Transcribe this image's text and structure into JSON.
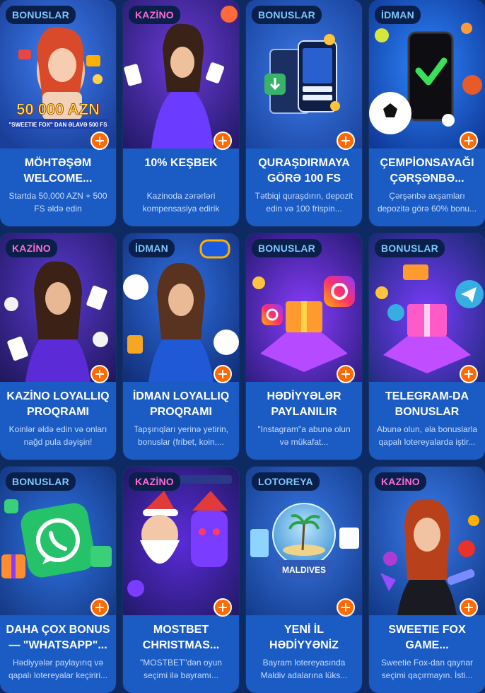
{
  "cards": [
    {
      "badge": "BONUSLAR",
      "badge_type": "bonus",
      "title_line1": "MÖHTƏŞƏM",
      "title_line2": "WELCOME...",
      "desc_line1": "Startda 50,000 AZN + 500",
      "desc_line2": "FS əldə edin",
      "image_text1": "50 000 AZN",
      "image_text2": "\"SWEETIE FOX\" DAN ƏLAVƏ 500 FS"
    },
    {
      "badge": "KAZİNO",
      "badge_type": "kazino",
      "title_line1": "10% KEŞBEK",
      "title_line2": "",
      "desc_line1": "Kazinoda zərərləri",
      "desc_line2": "kompensasiya edirik"
    },
    {
      "badge": "BONUSLAR",
      "badge_type": "bonus",
      "title_line1": "QURAŞDIRMAYA",
      "title_line2": "GÖRƏ 100 FS",
      "desc_line1": "Tətbiqi quraşdırın, depozit",
      "desc_line2": "edin və 100 frispin..."
    },
    {
      "badge": "İDMAN",
      "badge_type": "idman",
      "title_line1": "ÇEMPİONSAYAĞI",
      "title_line2": "ÇƏRŞƏNBƏ...",
      "desc_line1": "Çərşənbə axşamları",
      "desc_line2": "depozitə görə 60% bonu..."
    },
    {
      "badge": "KAZİNO",
      "badge_type": "kazino",
      "title_line1": "KAZİNO LOYALLIQ",
      "title_line2": "PROQRAMI",
      "desc_line1": "Koinlər əldə edin və onları",
      "desc_line2": "nağd pula dəyişin!"
    },
    {
      "badge": "İDMAN",
      "badge_type": "idman",
      "title_line1": "İDMAN LOYALLIQ",
      "title_line2": "PROQRAMI",
      "desc_line1": "Tapşırıqları yerinə yetirin,",
      "desc_line2": "bonuslar (fribet, koin,..."
    },
    {
      "badge": "BONUSLAR",
      "badge_type": "bonus",
      "title_line1": "HƏDİYYƏLƏR",
      "title_line2": "PAYLANILIR",
      "desc_line1": "\"Instagram\"a abunə olun",
      "desc_line2": "və mükafat..."
    },
    {
      "badge": "BONUSLAR",
      "badge_type": "bonus",
      "title_line1": "TELEGRAM-DA",
      "title_line2": "BONUSLAR",
      "desc_line1": "Abunə olun, əla bonuslarla",
      "desc_line2": "qapalı lotereyalarda iştir..."
    },
    {
      "badge": "BONUSLAR",
      "badge_type": "bonus",
      "title_line1": "DAHA ÇOX BONUS",
      "title_line2": "— \"WHATSAPP\"...",
      "desc_line1": "Hədiyyələr paylayırıq və",
      "desc_line2": "qapalı lotereyalar keçiriri..."
    },
    {
      "badge": "KAZİNO",
      "badge_type": "kazino",
      "title_line1": "MOSTBET",
      "title_line2": "CHRISTMAS...",
      "desc_line1": "\"MOSTBET\"dən oyun",
      "desc_line2": "seçimi ilə bayramı..."
    },
    {
      "badge": "LOTOREYA",
      "badge_type": "lotoreya",
      "title_line1": "YENİ İL",
      "title_line2": "HƏDİYYƏNİZ",
      "desc_line1": "Bayram lotereyasında",
      "desc_line2": "Maldiv adalarına lüks...",
      "image_text1": "MALDIVES"
    },
    {
      "badge": "KAZİNO",
      "badge_type": "kazino",
      "title_line1": "SWEETIE FOX",
      "title_line2": "GAME...",
      "desc_line1": "Sweetie Fox-dan qaynar",
      "desc_line2": "seçimi qaçırmayın. İsti..."
    }
  ],
  "colors": {
    "card_bg": "#1a5bc4",
    "page_bg": "#0e2a63",
    "plus": "#ff6a00",
    "kazino_badge": "#ff6bd6",
    "bonus_badge": "#7cc8ff"
  },
  "icons": [
    "plus-icon"
  ]
}
